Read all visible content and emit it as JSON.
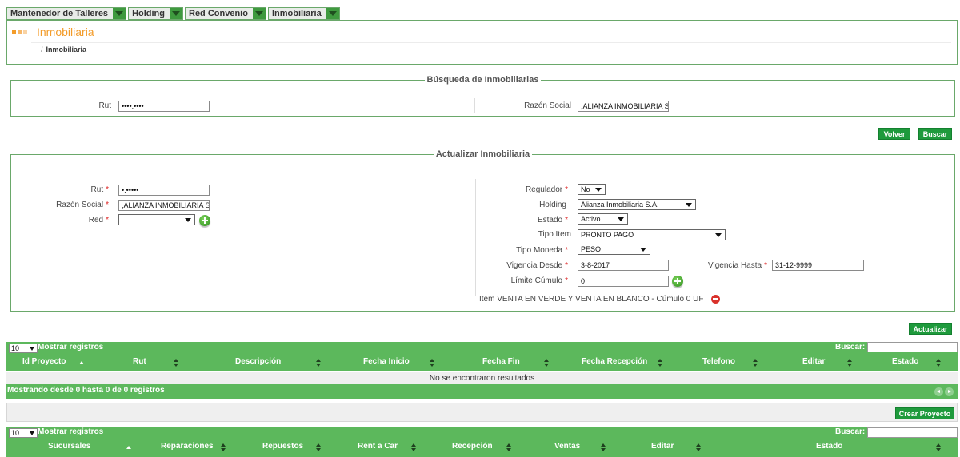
{
  "menu": {
    "items": [
      {
        "label": "Mantenedor de Talleres"
      },
      {
        "label": "Holding"
      },
      {
        "label": "Red Convenio"
      },
      {
        "label": "Inmobiliaria"
      }
    ]
  },
  "header": {
    "title": "Inmobiliaria",
    "breadcrumb_sep": "/",
    "breadcrumb": "Inmobiliaria",
    "dot_colors": [
      "#f39c2a",
      "#f6b768",
      "#f9d3a4"
    ]
  },
  "search": {
    "legend": "Búsqueda de Inmobiliarias",
    "rut_label": "Rut",
    "rut_value": "••••.••••",
    "razon_label": "Razón Social",
    "razon_value": ",ALIANZA INMOBILIARIA S",
    "back_button": "Volver",
    "search_button": "Buscar"
  },
  "update": {
    "legend": "Actualizar Inmobiliaria",
    "required_mark": "*",
    "rut_label": "Rut",
    "rut_value": "•.•••••",
    "razon_label": "Razón Social",
    "razon_value": ",ALIANZA INMOBILIARIA S",
    "red_label": "Red",
    "red_value": "",
    "regulador_label": "Regulador",
    "regulador_value": "No",
    "holding_label": "Holding",
    "holding_value": "Alianza Inmobiliaria S.A.",
    "estado_label": "Estado",
    "estado_value": "Activo",
    "tipo_item_label": "Tipo Item",
    "tipo_item_value": "PRONTO PAGO",
    "tipo_moneda_label": "Tipo Moneda",
    "tipo_moneda_value": "PESO",
    "vigencia_desde_label": "Vigencia Desde",
    "vigencia_desde_value": "3-8-2017",
    "vigencia_hasta_label": "Vigencia Hasta",
    "vigencia_hasta_value": "31-12-9999",
    "limite_label": "Límite Cúmulo",
    "limite_value": "0",
    "item_text": "Item VENTA EN VERDE Y VENTA EN BLANCO - Cúmulo 0 UF",
    "update_button": "Actualizar"
  },
  "projects_table": {
    "length_value": "10",
    "length_label": "Mostrar registros",
    "search_label": "Buscar:",
    "columns": [
      "Id Proyecto",
      "Rut",
      "Descripción",
      "Fecha Inicio",
      "Fecha Fin",
      "Fecha Recepción",
      "Telefono",
      "Editar",
      "Estado"
    ],
    "empty_text": "No se encontraron resultados",
    "info_text": "Mostrando desde 0 hasta 0 de 0 registros",
    "create_button": "Crear Proyecto"
  },
  "branches_table": {
    "length_value": "10",
    "length_label": "Mostrar registros",
    "search_label": "Buscar:",
    "columns": [
      "Sucursales",
      "Reparaciones",
      "Repuestos",
      "Rent a Car",
      "Recepción",
      "Ventas",
      "Editar",
      "Estado"
    ]
  },
  "colors": {
    "accent_orange": "#f39c2a",
    "green_border": "#6aa86a",
    "green_button": "#1e9a3c",
    "grid_green": "#5cb85c"
  }
}
